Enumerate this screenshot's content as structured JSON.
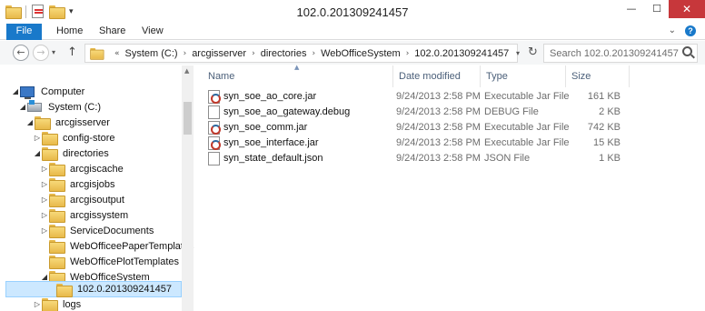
{
  "window": {
    "title": "102.0.201309241457",
    "minimize_glyph": "—",
    "maximize_glyph": "☐",
    "close_glyph": "✕"
  },
  "qat": {
    "icons": [
      "folder-icon",
      "properties-icon",
      "new-folder-icon",
      "customize-arrow-icon"
    ],
    "arrow_glyph": "▾"
  },
  "ribbon": {
    "tabs": [
      "File",
      "Home",
      "Share",
      "View"
    ],
    "expand_glyph": "⌄",
    "help_glyph": "?"
  },
  "address": {
    "back_glyph": "←",
    "forward_glyph": "→",
    "recent_glyph": "▾",
    "up_glyph": "↑",
    "overflow": "«",
    "separator": "›",
    "crumbs": [
      "System (C:)",
      "arcgisserver",
      "directories",
      "WebOfficeSystem",
      "102.0.201309241457"
    ],
    "dropdown_glyph": "▾",
    "refresh_glyph": "↻"
  },
  "search": {
    "placeholder": "Search 102.0.201309241457"
  },
  "columns": {
    "name": "Name",
    "date": "Date modified",
    "type": "Type",
    "size": "Size",
    "sort_glyph": "▲"
  },
  "files": [
    {
      "name": "syn_soe_ao_core.jar",
      "date": "9/24/2013 2:58 PM",
      "type": "Executable Jar File",
      "size": "161 KB",
      "icon": "jar-file-icon"
    },
    {
      "name": "syn_soe_ao_gateway.debug",
      "date": "9/24/2013 2:58 PM",
      "type": "DEBUG File",
      "size": "2 KB",
      "icon": "generic-file-icon"
    },
    {
      "name": "syn_soe_comm.jar",
      "date": "9/24/2013 2:58 PM",
      "type": "Executable Jar File",
      "size": "742 KB",
      "icon": "jar-file-icon"
    },
    {
      "name": "syn_soe_interface.jar",
      "date": "9/24/2013 2:58 PM",
      "type": "Executable Jar File",
      "size": "15 KB",
      "icon": "jar-file-icon"
    },
    {
      "name": "syn_state_default.json",
      "date": "9/24/2013 2:58 PM",
      "type": "JSON File",
      "size": "1 KB",
      "icon": "generic-file-icon"
    }
  ],
  "tree": {
    "expanded_glyph": "◢",
    "collapsed_glyph": "▷",
    "scroll_up_glyph": "▲",
    "items": [
      {
        "label": "Computer",
        "icon": "computer-icon",
        "state": "expanded"
      },
      {
        "label": "System (C:)",
        "icon": "drive-icon",
        "state": "expanded"
      },
      {
        "label": "arcgisserver",
        "icon": "folder-icon",
        "state": "expanded"
      },
      {
        "label": "config-store",
        "icon": "folder-icon",
        "state": "collapsed"
      },
      {
        "label": "directories",
        "icon": "folder-icon",
        "state": "expanded"
      },
      {
        "label": "arcgiscache",
        "icon": "folder-icon",
        "state": "collapsed"
      },
      {
        "label": "arcgisjobs",
        "icon": "folder-icon",
        "state": "collapsed"
      },
      {
        "label": "arcgisoutput",
        "icon": "folder-icon",
        "state": "collapsed"
      },
      {
        "label": "arcgissystem",
        "icon": "folder-icon",
        "state": "collapsed"
      },
      {
        "label": "ServiceDocuments",
        "icon": "folder-icon",
        "state": "collapsed"
      },
      {
        "label": "WebOfficeePaperTemplates",
        "icon": "folder-icon",
        "state": "none"
      },
      {
        "label": "WebOfficePlotTemplates",
        "icon": "folder-icon",
        "state": "none"
      },
      {
        "label": "WebOfficeSystem",
        "icon": "folder-icon",
        "state": "expanded"
      },
      {
        "label": "102.0.201309241457",
        "icon": "folder-icon",
        "state": "selected"
      },
      {
        "label": "logs",
        "icon": "folder-icon",
        "state": "collapsed"
      }
    ]
  },
  "colors": {
    "accent": "#1979ca",
    "selection": "#cce8ff",
    "close_button": "#c7373b"
  }
}
